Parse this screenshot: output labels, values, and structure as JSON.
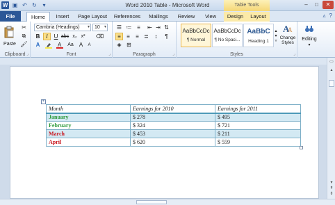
{
  "window": {
    "title": "Word 2010 Table - Microsoft Word",
    "context_header": "Table Tools"
  },
  "tabs": [
    "File",
    "Home",
    "Insert",
    "Page Layout",
    "References",
    "Mailings",
    "Review",
    "View",
    "Design",
    "Layout"
  ],
  "ribbon": {
    "clipboard": {
      "paste": "Paste",
      "label": "Clipboard"
    },
    "font": {
      "name": "Cambria (Headings)",
      "size": "10",
      "label": "Font"
    },
    "paragraph": {
      "label": "Paragraph"
    },
    "styles": {
      "label": "Styles",
      "items": [
        {
          "sample": "AaBbCcDc",
          "name": "¶ Normal"
        },
        {
          "sample": "AaBbCcDc",
          "name": "¶ No Spaci..."
        },
        {
          "sample": "AaBbC",
          "name": "Heading 1"
        }
      ],
      "change_styles": "Change Styles"
    },
    "editing": {
      "label": "Editing"
    }
  },
  "table": {
    "headers": [
      "Month",
      "Earnings for 2010",
      "Earnings for 2011"
    ],
    "rows": [
      {
        "month": "January",
        "e2010": "$ 278",
        "e2011": "$ 495",
        "color": "#2e9a3c"
      },
      {
        "month": "February",
        "e2010": "$ 324",
        "e2011": "$ 721",
        "color": "#2e9a3c"
      },
      {
        "month": "March",
        "e2010": "$ 453",
        "e2011": "$ 211",
        "color": "#c8141c"
      },
      {
        "month": "April",
        "e2010": "$ 620",
        "e2011": "$ 559",
        "color": "#c8141c"
      }
    ]
  },
  "colors": {
    "file_tab": "#2b5797",
    "table_band": "#d3e9f3",
    "table_border": "#7fb0c8"
  }
}
